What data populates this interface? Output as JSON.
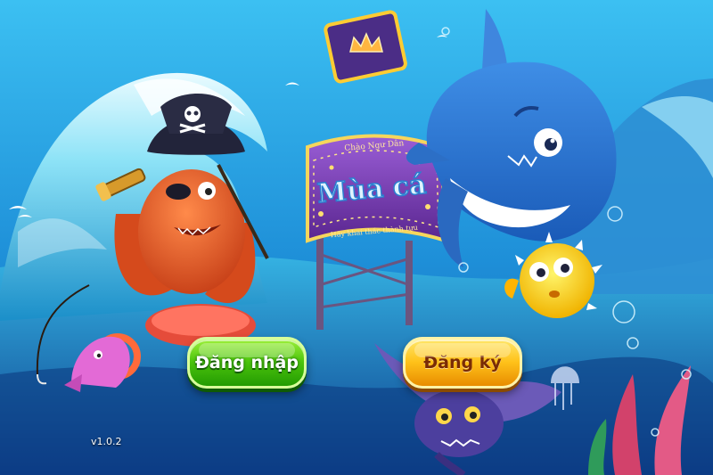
{
  "game": {
    "sign_small_top": "Chào Ngư Dân",
    "sign_title": "Mùa cá",
    "sign_small_bottom": "Hãy khai thác thành tựu",
    "version": "v1.0.2"
  },
  "buttons": {
    "login_label": "Đăng nhập",
    "register_label": "Đăng ký"
  },
  "colors": {
    "sky": "#2aa9e6",
    "sea": "#1560b8",
    "login_button": "#3fb80c",
    "register_button": "#ffc21a",
    "sign_purple": "#7a3fb0"
  },
  "icons": [
    "crown-icon",
    "skull-icon",
    "spyglass-icon",
    "fishing-hook-icon"
  ]
}
